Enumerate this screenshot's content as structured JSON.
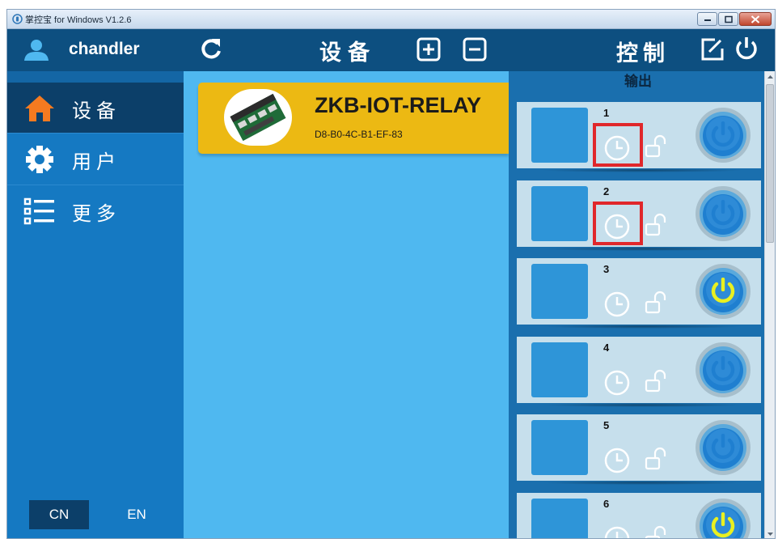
{
  "window": {
    "title": "掌控宝 for Windows V1.2.6",
    "controls": [
      "minimize-icon",
      "maximize-icon",
      "close-icon"
    ]
  },
  "sidebar": {
    "username": "chandler",
    "items": [
      {
        "label": "设备",
        "icon": "home-icon",
        "active": true
      },
      {
        "label": "用户",
        "icon": "gear-icon",
        "active": false
      },
      {
        "label": "更多",
        "icon": "list-icon",
        "active": false
      }
    ],
    "languages": {
      "cn": "CN",
      "en": "EN"
    }
  },
  "devices": {
    "title": "设备",
    "list": [
      {
        "name": "ZKB-IOT-RELAY",
        "mac": "D8-B0-4C-B1-EF-83"
      }
    ]
  },
  "control": {
    "title": "控制",
    "section": "输出",
    "relays": [
      {
        "number": "1",
        "power_color": "#1f7fd0",
        "highlighted": true
      },
      {
        "number": "2",
        "power_color": "#1f7fd0",
        "highlighted": true
      },
      {
        "number": "3",
        "power_color": "#e9f021",
        "highlighted": false
      },
      {
        "number": "4",
        "power_color": "#1f7fd0",
        "highlighted": false
      },
      {
        "number": "5",
        "power_color": "#1f7fd0",
        "highlighted": false
      },
      {
        "number": "6",
        "power_color": "#e9f021",
        "highlighted": false
      }
    ]
  },
  "colors": {
    "header": "#0d4f80",
    "sidebar": "#1579c2",
    "device_panel": "#4fb8f0",
    "device_card": "#ecb913",
    "relay_row": "#c6dfec",
    "highlight": "#e0272b"
  }
}
